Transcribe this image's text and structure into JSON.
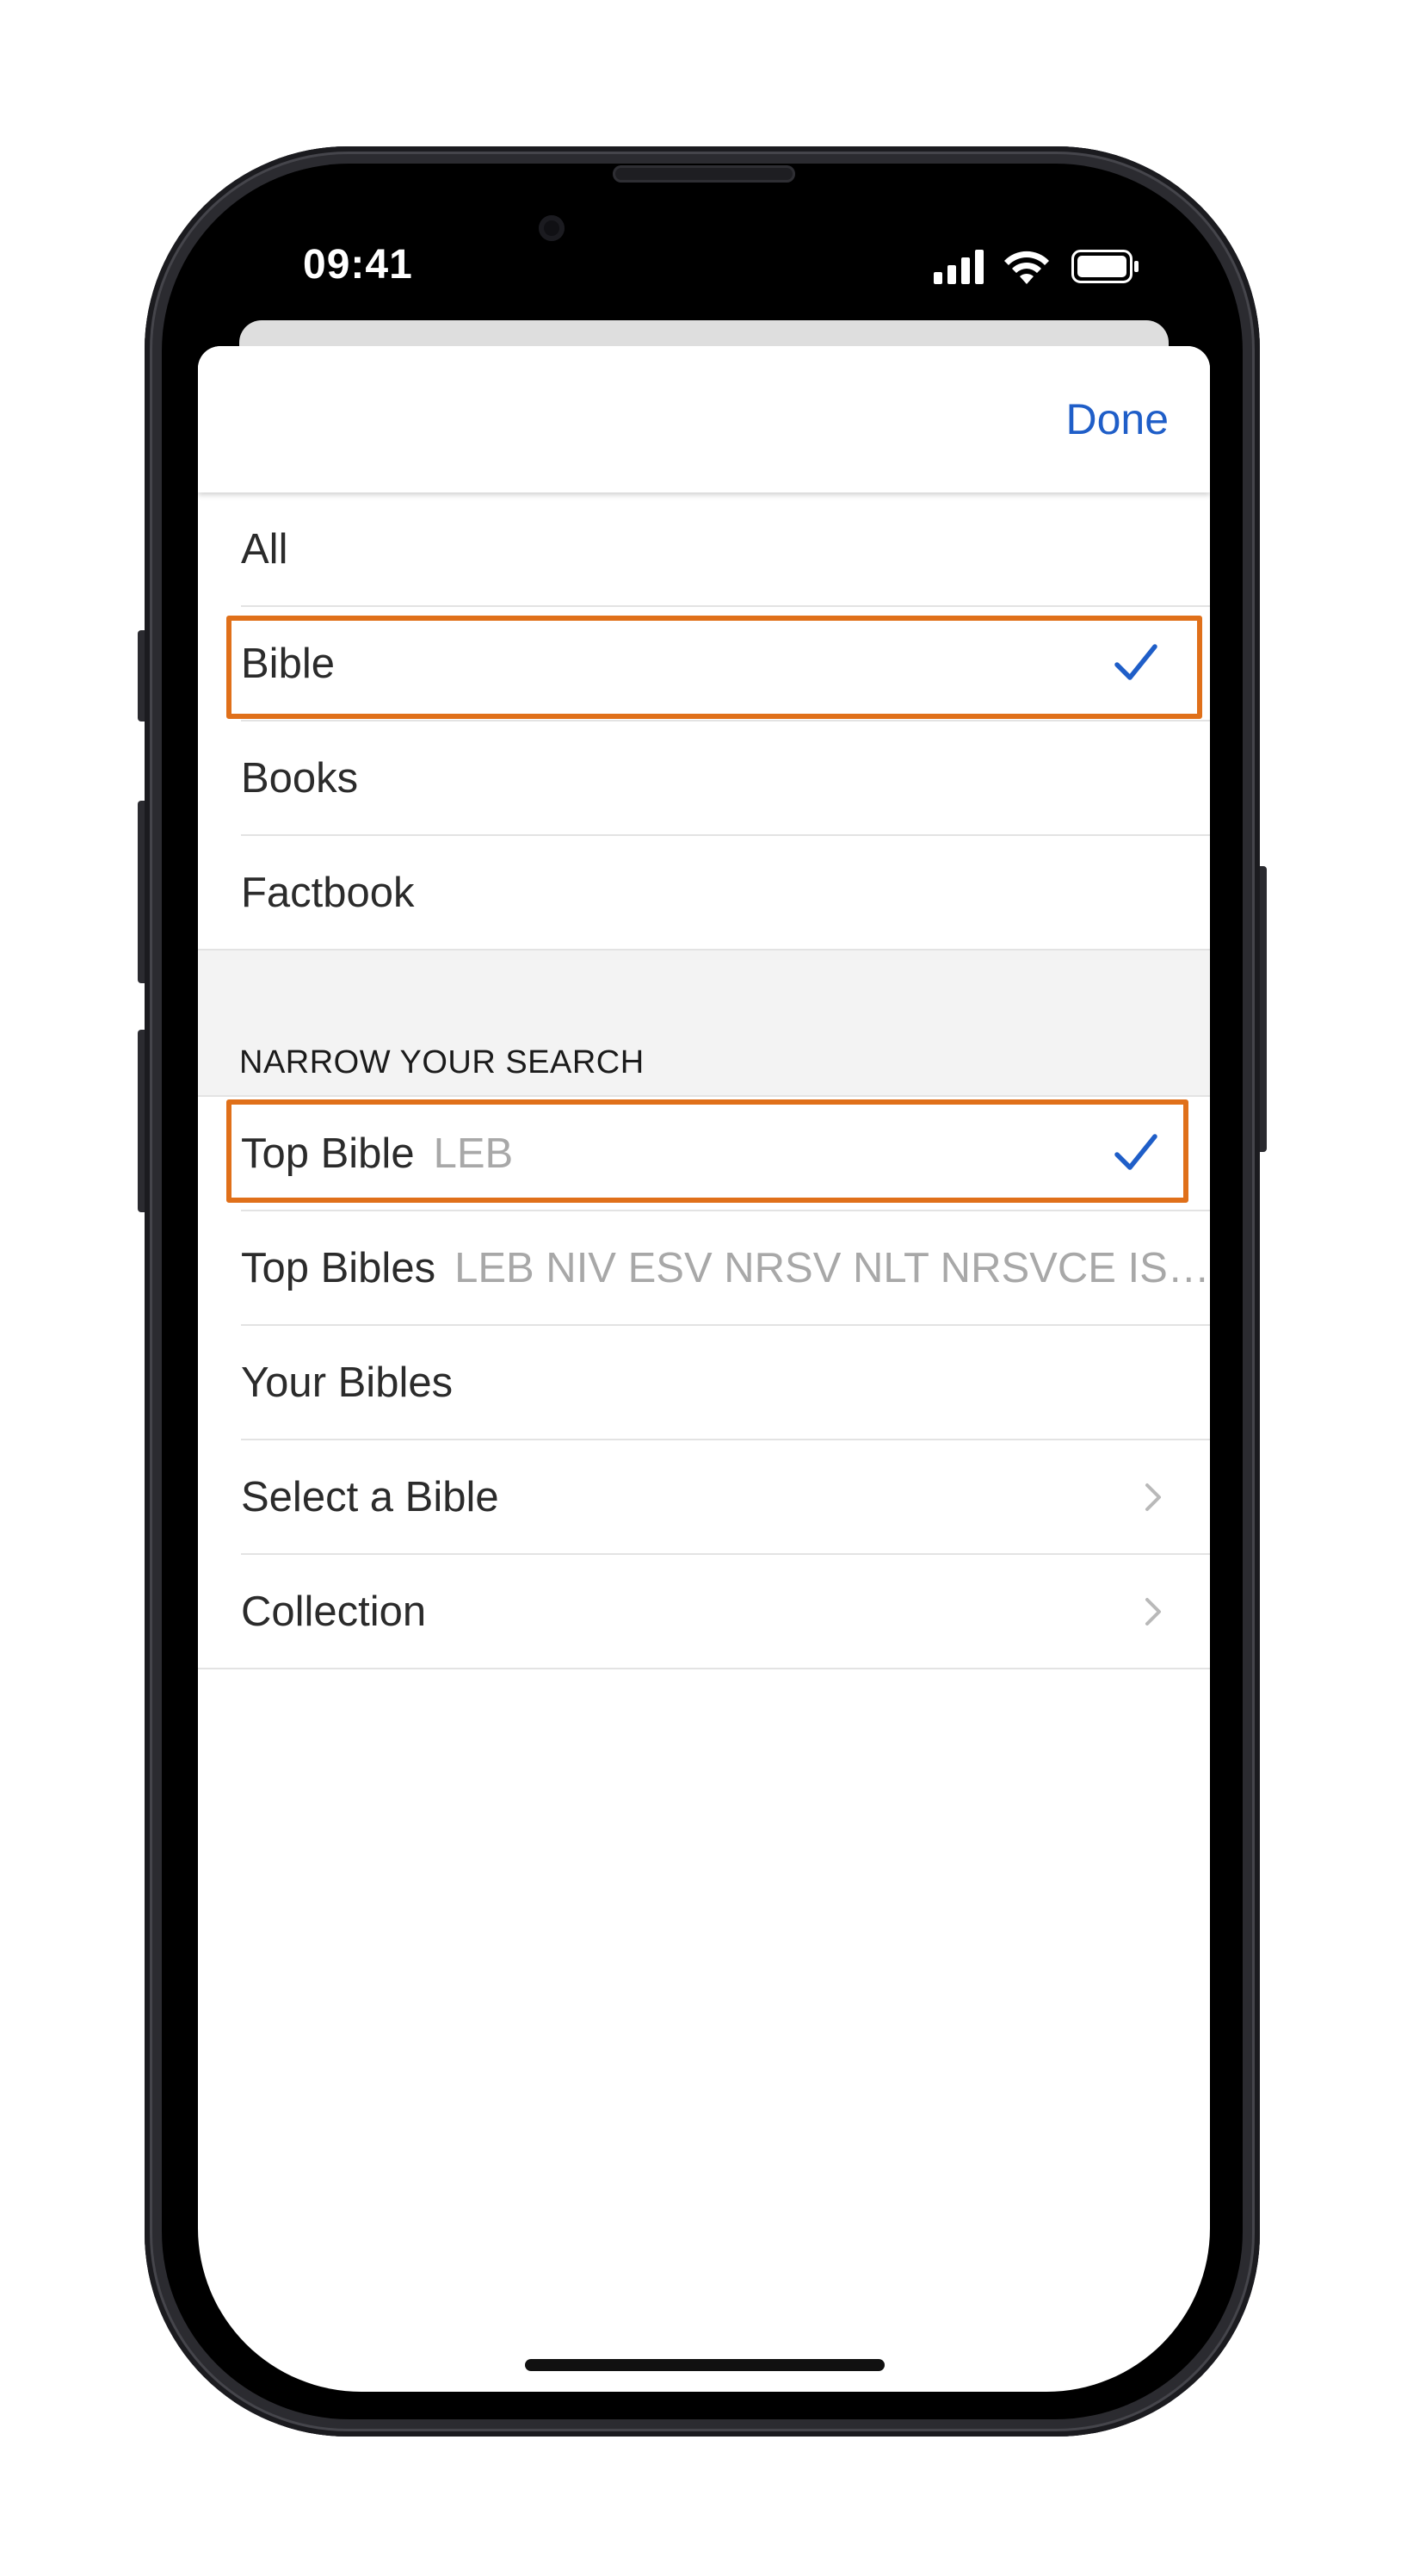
{
  "status_bar": {
    "time": "09:41",
    "icons": [
      "cellular-signal-icon",
      "wifi-icon",
      "battery-icon"
    ]
  },
  "header": {
    "done_label": "Done"
  },
  "scope_options": [
    {
      "label": "All",
      "selected": false
    },
    {
      "label": "Bible",
      "selected": true
    },
    {
      "label": "Books",
      "selected": false
    },
    {
      "label": "Factbook",
      "selected": false
    }
  ],
  "narrow_section": {
    "title": "NARROW YOUR SEARCH",
    "items": [
      {
        "label": "Top Bible",
        "detail": "LEB",
        "selected": true
      },
      {
        "label": "Top Bibles",
        "detail": "LEB NIV ESV NRSV NLT NRSVCE IS…",
        "selected": false
      },
      {
        "label": "Your Bibles",
        "detail": "",
        "selected": false
      },
      {
        "label": "Select a Bible",
        "detail": "",
        "selected": false,
        "disclosure": true
      },
      {
        "label": "Collection",
        "detail": "",
        "selected": false,
        "disclosure": true
      }
    ]
  },
  "colors": {
    "accent": "#1f5ec8",
    "highlight": "#e0701a",
    "section_background": "#f3f3f3",
    "detail_text": "#a8a8a8"
  }
}
